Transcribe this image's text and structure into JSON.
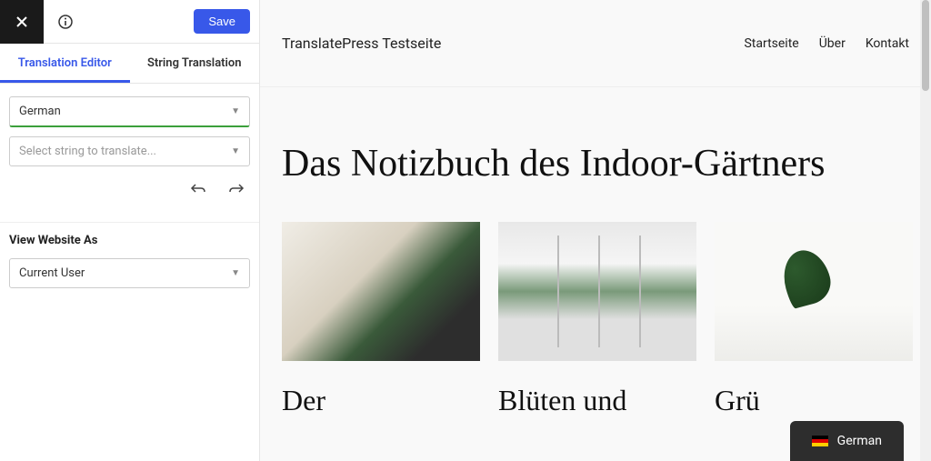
{
  "sidebar": {
    "save_label": "Save",
    "tabs": [
      {
        "label": "Translation Editor"
      },
      {
        "label": "String Translation"
      }
    ],
    "language_select": {
      "value": "German"
    },
    "string_select": {
      "placeholder": "Select string to translate..."
    },
    "view_as_label": "View Website As",
    "view_as_select": {
      "value": "Current User"
    }
  },
  "preview": {
    "site_title": "TranslatePress Testseite",
    "nav": [
      {
        "label": "Startseite"
      },
      {
        "label": "Über"
      },
      {
        "label": "Kontakt"
      }
    ],
    "page_title": "Das Notizbuch des Indoor-Gärtners",
    "cards": [
      {
        "title": "Der"
      },
      {
        "title": "Blüten und"
      },
      {
        "title": "Grü"
      }
    ],
    "lang_switcher": {
      "label": "German"
    }
  },
  "icons": {
    "close": "close-icon",
    "info": "info-icon",
    "undo": "undo-arrow-icon",
    "redo": "redo-arrow-icon",
    "caret": "chevron-down-icon"
  }
}
